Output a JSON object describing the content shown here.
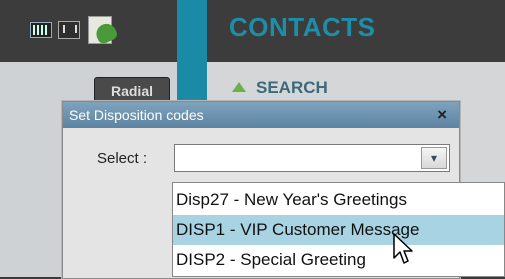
{
  "header": {
    "title": "CONTACTS",
    "icons": [
      "keyboard-icon",
      "phone-book-icon",
      "phone-list-icon"
    ]
  },
  "panel": {
    "search_label": "SEARCH",
    "radial_button_label": "Radial"
  },
  "dialog": {
    "title": "Set Disposition codes",
    "close_label": "×",
    "select_label": "Select :",
    "select_value": "",
    "arrow_glyph": "▾",
    "options": [
      {
        "label": "Disp27 - New Year's Greetings",
        "selected": false
      },
      {
        "label": "DISP1 - VIP Customer Message",
        "selected": true
      },
      {
        "label": "DISP2 - Special Greeting",
        "selected": false
      }
    ]
  },
  "colors": {
    "accent": "#1a8aa6",
    "title_bar": "#6a8fab",
    "selected_option": "#a7d3e3"
  }
}
